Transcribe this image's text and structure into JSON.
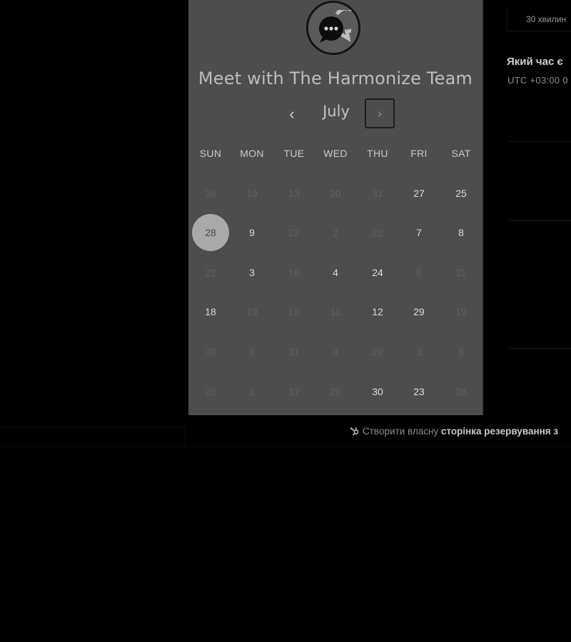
{
  "meeting": {
    "title": "Meet with The Harmonize Team",
    "duration": "30 хвилин"
  },
  "calendar": {
    "month": "July",
    "prev_label": "‹",
    "next_label": "›",
    "weekdays": [
      "SUN",
      "MON",
      "TUE",
      "WED",
      "THU",
      "FRI",
      "SAT"
    ],
    "weeks": [
      [
        {
          "d": "16",
          "a": false
        },
        {
          "d": "19",
          "a": false
        },
        {
          "d": "13",
          "a": false
        },
        {
          "d": "20",
          "a": false
        },
        {
          "d": "31",
          "a": false
        },
        {
          "d": "27",
          "a": true
        },
        {
          "d": "25",
          "a": true
        }
      ],
      [
        {
          "d": "28",
          "a": true,
          "s": true
        },
        {
          "d": "9",
          "a": true
        },
        {
          "d": "22",
          "a": false
        },
        {
          "d": "2",
          "a": false
        },
        {
          "d": "22",
          "a": false
        },
        {
          "d": "7",
          "a": true
        },
        {
          "d": "8",
          "a": true
        }
      ],
      [
        {
          "d": "22",
          "a": false
        },
        {
          "d": "3",
          "a": true
        },
        {
          "d": "16",
          "a": false
        },
        {
          "d": "4",
          "a": true
        },
        {
          "d": "24",
          "a": true
        },
        {
          "d": "6",
          "a": false
        },
        {
          "d": "21",
          "a": false
        }
      ],
      [
        {
          "d": "18",
          "a": true
        },
        {
          "d": "19",
          "a": false
        },
        {
          "d": "10",
          "a": false
        },
        {
          "d": "11",
          "a": false
        },
        {
          "d": "12",
          "a": true
        },
        {
          "d": "29",
          "a": true
        },
        {
          "d": "19",
          "a": false
        }
      ],
      [
        {
          "d": "30",
          "a": false
        },
        {
          "d": "9",
          "a": false
        },
        {
          "d": "11",
          "a": false
        },
        {
          "d": "4",
          "a": false
        },
        {
          "d": "29",
          "a": false
        },
        {
          "d": "3",
          "a": false
        },
        {
          "d": "8",
          "a": false
        }
      ],
      [
        {
          "d": "25",
          "a": false
        },
        {
          "d": "1",
          "a": false
        },
        {
          "d": "17",
          "a": false
        },
        {
          "d": "28",
          "a": false
        },
        {
          "d": "30",
          "a": true
        },
        {
          "d": "23",
          "a": true
        },
        {
          "d": "28",
          "a": false
        }
      ]
    ]
  },
  "time_panel": {
    "question": "Який час є",
    "timezone": "UTC +03:00 0"
  },
  "footer": {
    "prefix": "Створити власну",
    "link": "сторінка резервування з"
  },
  "colors": {
    "panel_bg": "#4d4d4d",
    "selected_day_bg": "#a9a9a9",
    "page_bg": "#000000"
  }
}
